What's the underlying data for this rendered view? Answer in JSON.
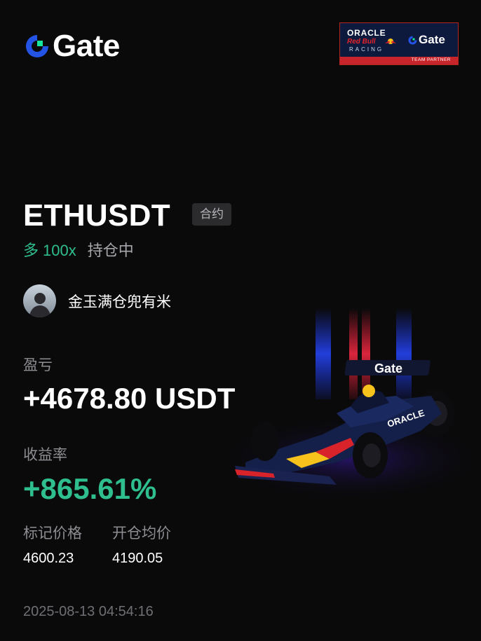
{
  "brand": {
    "name": "Gate",
    "icon": "gate-logo-icon",
    "accent_blue": "#2354e6",
    "accent_green": "#17e6a1"
  },
  "partner_badge": {
    "oracle": "ORACLE",
    "redbull": "Red Bull",
    "racing": "RACING",
    "gate": "Gate",
    "caption": "TEAM PARTNER"
  },
  "position": {
    "pair": "ETHUSDT",
    "type_badge": "合约",
    "direction": "多",
    "leverage": "100x",
    "status": "持仓中",
    "colors": {
      "long": "#2fbe8e"
    }
  },
  "user": {
    "name": "金玉满仓兜有米",
    "avatar_icon": "avatar-silhouette-icon"
  },
  "pnl": {
    "label": "盈亏",
    "value": "+4678.80 USDT"
  },
  "roi": {
    "label": "收益率",
    "value": "+865.61%"
  },
  "prices": {
    "mark_label": "标记价格",
    "mark_value": "4600.23",
    "entry_label": "开仓均价",
    "entry_value": "4190.05"
  },
  "timestamp": "2025-08-13 04:54:16",
  "car": {
    "livery_text": "Gate",
    "sponsor_text": "ORACLE"
  }
}
